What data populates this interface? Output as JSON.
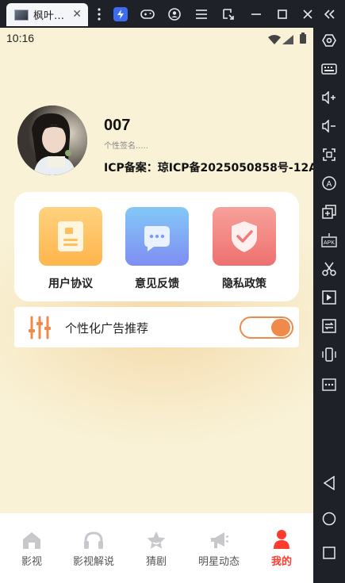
{
  "window": {
    "tab_title": "枫叶…",
    "tab_close": "✕"
  },
  "status": {
    "time": "10:16"
  },
  "profile": {
    "username": "007",
    "signature": "个性签名.....",
    "icp": "ICP备案：琼ICP备2025050858号-12A"
  },
  "cards": [
    {
      "label": "用户协议",
      "icon": "document-icon"
    },
    {
      "label": "意见反馈",
      "icon": "chat-icon"
    },
    {
      "label": "隐私政策",
      "icon": "shield-check-icon"
    }
  ],
  "ad_setting": {
    "label": "个性化广告推荐",
    "enabled": true
  },
  "nav": [
    {
      "label": "影视",
      "icon": "home-icon"
    },
    {
      "label": "影视解说",
      "icon": "headphones-icon"
    },
    {
      "label": "猜剧",
      "icon": "star-icon"
    },
    {
      "label": "明星动态",
      "icon": "megaphone-icon"
    },
    {
      "label": "我的",
      "icon": "user-icon"
    }
  ],
  "colors": {
    "accent": "#f08a4b",
    "active_nav": "#ff3b30",
    "card1": "#ffc46b",
    "card2": "#7e9bf5",
    "card3": "#f07f7f"
  }
}
